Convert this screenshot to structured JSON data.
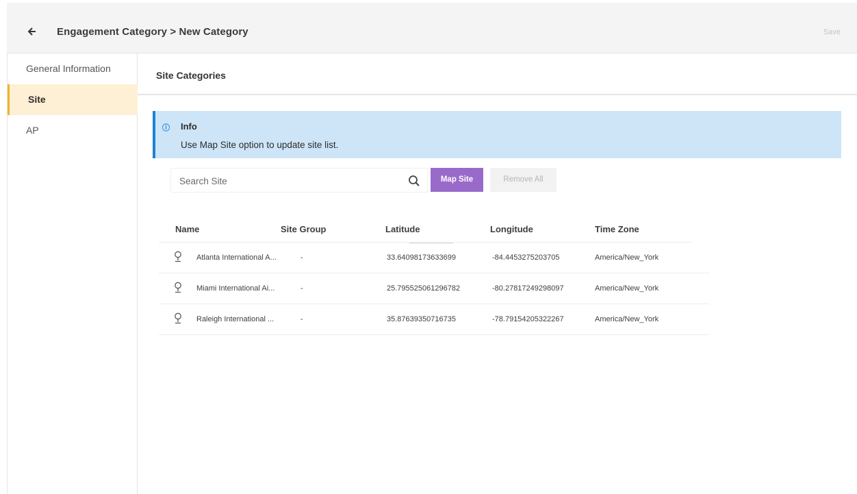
{
  "header": {
    "breadcrumb": "Engagement Category > New Category",
    "save_label": "Save"
  },
  "sidebar": {
    "items": [
      {
        "label": "General Information",
        "active": false
      },
      {
        "label": "Site",
        "active": true
      },
      {
        "label": "AP",
        "active": false
      }
    ]
  },
  "content": {
    "section_title": "Site Categories",
    "info": {
      "icon": "info-icon",
      "title": "Info",
      "text": "Use Map Site option to update site list."
    },
    "search": {
      "placeholder": "Search Site",
      "value": ""
    },
    "buttons": {
      "map_site": "Map Site",
      "remove_all": "Remove All"
    },
    "table": {
      "columns": [
        "Name",
        "Site Group",
        "Latitude",
        "Longitude",
        "Time Zone"
      ],
      "rows": [
        {
          "name": "Atlanta International A...",
          "group": "-",
          "lat": "33.64098173633699",
          "lng": "-84.4453275203705",
          "tz": "America/New_York"
        },
        {
          "name": "Miami International Ai...",
          "group": "-",
          "lat": "25.795525061296782",
          "lng": "-80.27817249298097",
          "tz": "America/New_York"
        },
        {
          "name": "Raleigh International ...",
          "group": "-",
          "lat": "35.87639350716735",
          "lng": "-78.79154205322267",
          "tz": "America/New_York"
        }
      ]
    }
  },
  "colors": {
    "accent_purple": "#9a6acb",
    "info_bg": "#cde5f7",
    "info_border": "#1f82d0",
    "active_nav_bg": "#fdf0d5",
    "active_nav_border": "#f0b429"
  }
}
